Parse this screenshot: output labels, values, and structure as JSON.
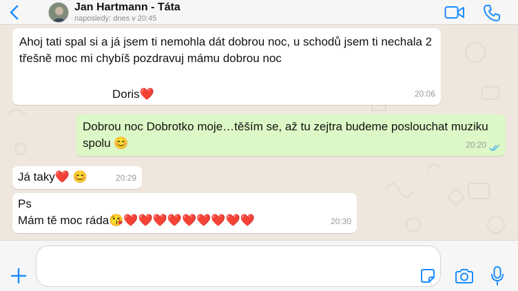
{
  "header": {
    "contact_name": "Jan Hartmann - Táta",
    "status": "naposledy: dnes v 20:45",
    "back_icon": "chevron-left-icon",
    "video_icon": "video-camera-icon",
    "call_icon": "phone-icon",
    "accent_color": "#1a8cff"
  },
  "messages": [
    {
      "direction": "incoming",
      "text": "Ahoj tati spal si a já jsem ti nemohla dát dobrou noc, u schodů jsem ti nechala 2 třešně moc mi chybíš pozdravuj mámu dobrou noc",
      "signature": "Doris❤️",
      "time": "20:06"
    },
    {
      "direction": "outgoing",
      "text": "Dobrou noc Dobrotko moje…těším se, až tu zejtra budeme poslouchat muziku spolu 😊",
      "time": "20:20",
      "read_status": "read",
      "ticks_icon": "double-check-icon"
    },
    {
      "direction": "incoming",
      "text": "Já taky❤️ 😊",
      "time": "20:29"
    },
    {
      "direction": "incoming",
      "line1": "Ps",
      "line2": "Mám tě moc ráda😘❤️❤️❤️❤️❤️❤️❤️❤️❤️",
      "time": "20:30"
    }
  ],
  "input": {
    "value": "",
    "placeholder": "",
    "plus_icon": "plus-icon",
    "sticker_icon": "sticker-icon",
    "camera_icon": "camera-icon",
    "mic_icon": "microphone-icon"
  },
  "colors": {
    "incoming_bubble": "#ffffff",
    "outgoing_bubble": "#dcf8c6",
    "chat_background": "#efe7dd",
    "read_ticks": "#4fb6ec"
  }
}
